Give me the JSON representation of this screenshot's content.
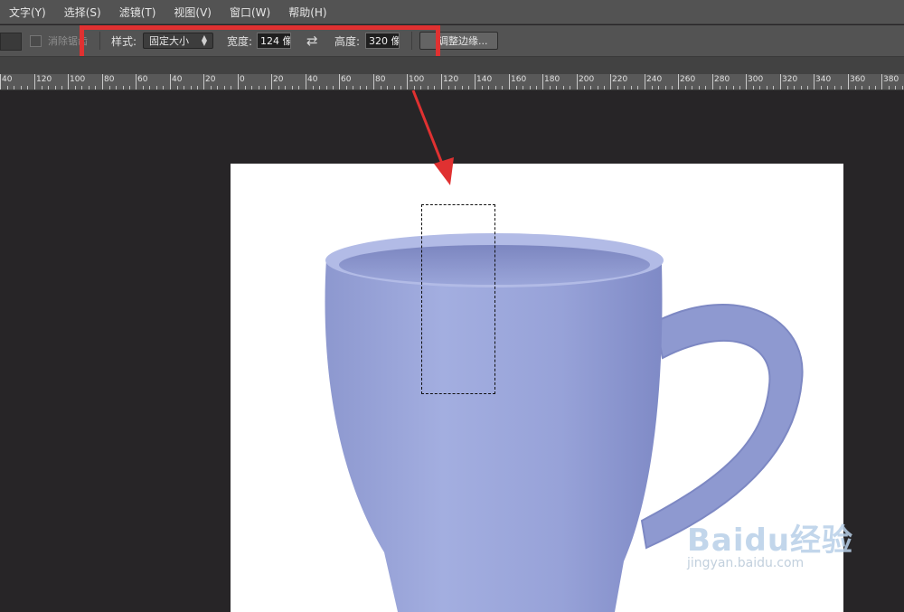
{
  "menubar": {
    "items": [
      "文字(Y)",
      "选择(S)",
      "滤镜(T)",
      "视图(V)",
      "窗口(W)",
      "帮助(H)"
    ]
  },
  "options": {
    "antialias_label": "消除锯齿",
    "style_label": "样式:",
    "style_value": "固定大小",
    "width_label": "宽度:",
    "width_value": "124 像",
    "height_label": "高度:",
    "height_value": "320 像",
    "swap_symbol": "⇄",
    "refine_edge_label": "调整边缘..."
  },
  "ruler": {
    "labels": [
      "40",
      "120",
      "100",
      "80",
      "60",
      "40",
      "20",
      "0",
      "20",
      "40",
      "60",
      "80",
      "100",
      "120",
      "140",
      "160",
      "180",
      "200",
      "220",
      "240",
      "260",
      "280",
      "300",
      "320",
      "340",
      "360",
      "380"
    ]
  },
  "watermark": {
    "logo": "Baidu经验",
    "url": "jingyan.baidu.com"
  },
  "colors": {
    "highlight": "#e03131",
    "mug": "#9aa6d8"
  }
}
